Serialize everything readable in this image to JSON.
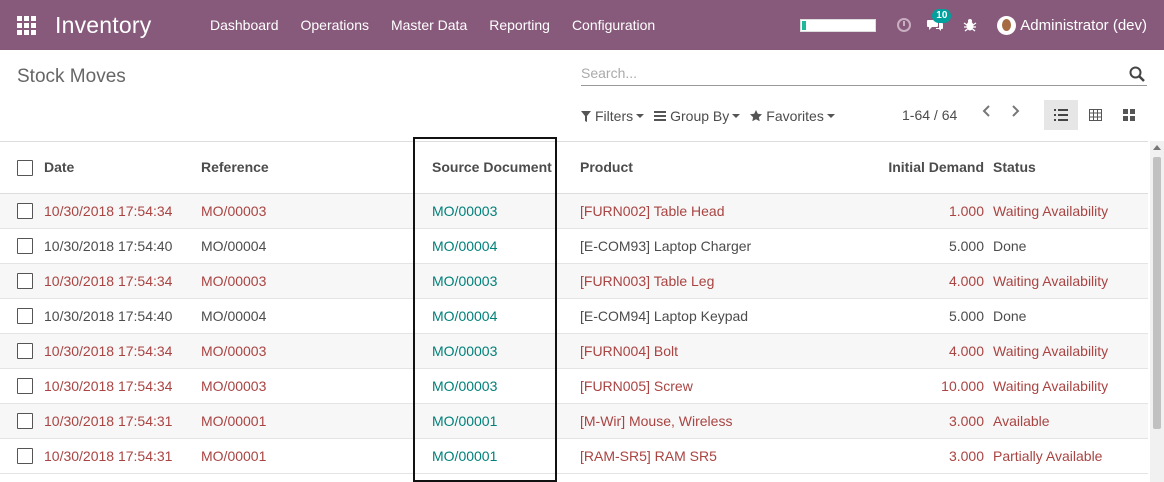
{
  "navbar": {
    "app_title": "Inventory",
    "menu": [
      "Dashboard",
      "Operations",
      "Master Data",
      "Reporting",
      "Configuration"
    ],
    "progress_fraction": 0.05,
    "messages_badge": "10",
    "user": "Administrator (dev)",
    "colors": {
      "navbar_bg": "#875a7b",
      "progress_fill": "#21b799",
      "badge": "#00a09d"
    },
    "icons": [
      "apps-grid-icon",
      "clock-icon",
      "chat-icon",
      "bug-icon",
      "avatar"
    ]
  },
  "control_panel": {
    "breadcrumb": "Stock Moves",
    "search_placeholder": "Search...",
    "filters_label": "Filters",
    "group_by_label": "Group By",
    "favorites_label": "Favorites",
    "pager": "1-64 / 64",
    "active_view": "list"
  },
  "table": {
    "columns": [
      "Date",
      "Reference",
      "Source Document",
      "Product",
      "Initial Demand",
      "Status"
    ],
    "rows": [
      {
        "date": "10/30/2018 17:54:34",
        "reference": "MO/00003",
        "source": "MO/00003",
        "product": "[FURN002] Table Head",
        "demand": "1.000",
        "status": "Waiting Availability",
        "state": "red"
      },
      {
        "date": "10/30/2018 17:54:40",
        "reference": "MO/00004",
        "source": "MO/00004",
        "product": "[E-COM93] Laptop Charger",
        "demand": "5.000",
        "status": "Done",
        "state": "plain"
      },
      {
        "date": "10/30/2018 17:54:34",
        "reference": "MO/00003",
        "source": "MO/00003",
        "product": "[FURN003] Table Leg",
        "demand": "4.000",
        "status": "Waiting Availability",
        "state": "red"
      },
      {
        "date": "10/30/2018 17:54:40",
        "reference": "MO/00004",
        "source": "MO/00004",
        "product": "[E-COM94] Laptop Keypad",
        "demand": "5.000",
        "status": "Done",
        "state": "plain"
      },
      {
        "date": "10/30/2018 17:54:34",
        "reference": "MO/00003",
        "source": "MO/00003",
        "product": "[FURN004] Bolt",
        "demand": "4.000",
        "status": "Waiting Availability",
        "state": "red"
      },
      {
        "date": "10/30/2018 17:54:34",
        "reference": "MO/00003",
        "source": "MO/00003",
        "product": "[FURN005] Screw",
        "demand": "10.000",
        "status": "Waiting Availability",
        "state": "red"
      },
      {
        "date": "10/30/2018 17:54:31",
        "reference": "MO/00001",
        "source": "MO/00001",
        "product": "[M-Wir] Mouse, Wireless",
        "demand": "3.000",
        "status": "Available",
        "state": "red"
      },
      {
        "date": "10/30/2018 17:54:31",
        "reference": "MO/00001",
        "source": "MO/00001",
        "product": "[RAM-SR5] RAM SR5",
        "demand": "3.000",
        "status": "Partially Available",
        "state": "red"
      }
    ]
  }
}
